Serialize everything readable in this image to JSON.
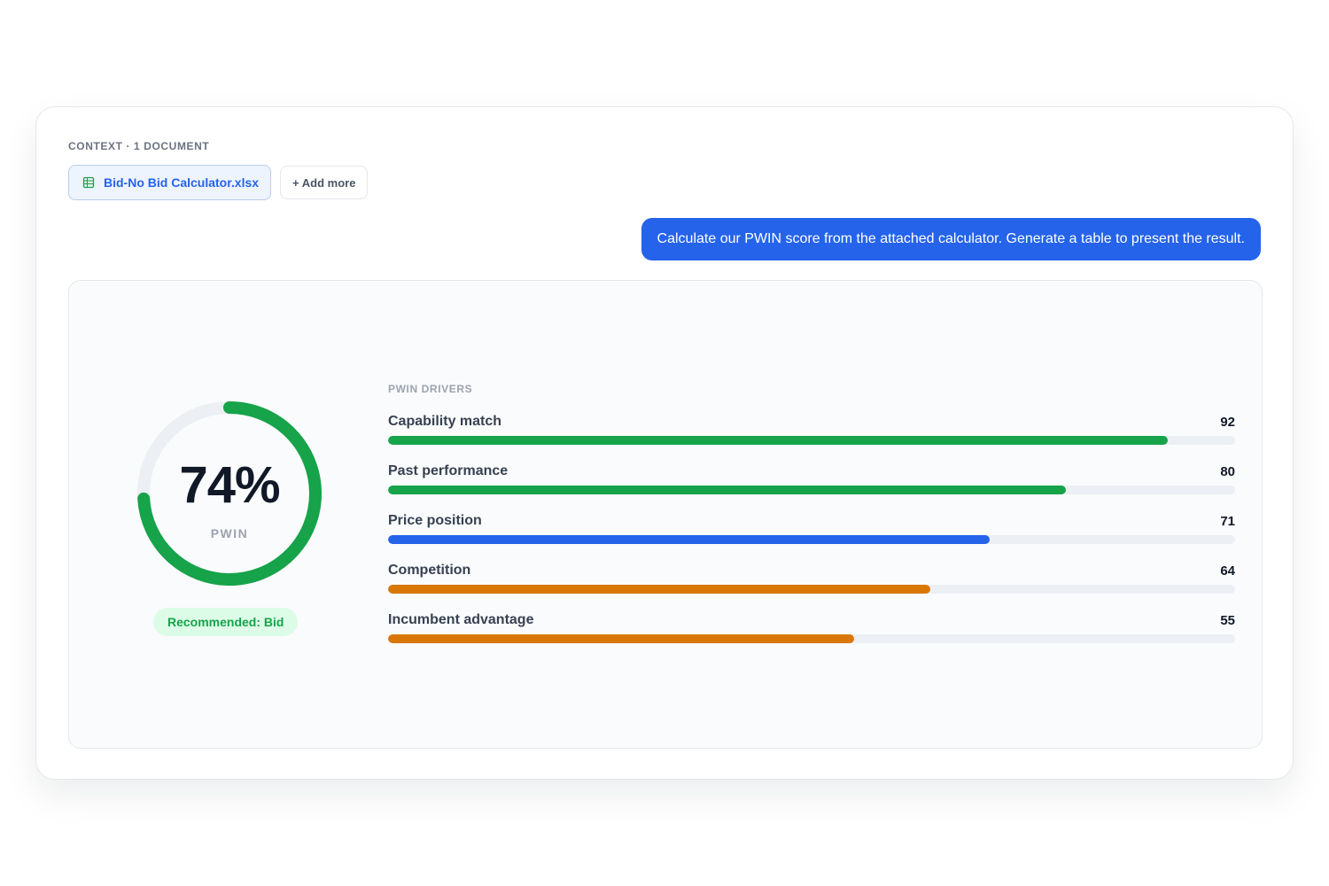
{
  "context": {
    "label": "CONTEXT · 1 DOCUMENT",
    "document": {
      "name": "Bid-No Bid Calculator.xlsx",
      "icon": "spreadsheet-icon"
    },
    "add_more_label": "+ Add more"
  },
  "message": {
    "text": "Calculate our PWIN score from the attached calculator. Generate a table to present the result."
  },
  "result": {
    "score": {
      "value": "74%",
      "percent": 74,
      "label": "PWIN"
    },
    "recommendation": "Recommended: Bid",
    "drivers_title": "PWIN DRIVERS",
    "drivers": [
      {
        "name": "Capability match",
        "value": 92,
        "color": "#16a34a"
      },
      {
        "name": "Past performance",
        "value": 80,
        "color": "#16a34a"
      },
      {
        "name": "Price position",
        "value": 71,
        "color": "#2563eb"
      },
      {
        "name": "Competition",
        "value": 64,
        "color": "#d97706"
      },
      {
        "name": "Incumbent advantage",
        "value": 55,
        "color": "#d97706"
      }
    ]
  },
  "colors": {
    "accent": "#2563eb",
    "success": "#16a34a",
    "warning": "#d97706"
  }
}
